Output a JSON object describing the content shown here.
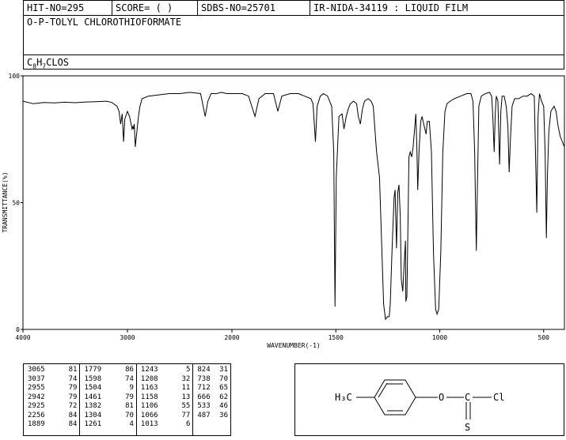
{
  "header": {
    "hit_no": "HIT-NO=295",
    "score": "SCORE=  (   )",
    "sdbs_no": "SDBS-NO=25701",
    "ir_info": "IR-NIDA-34119 : LIQUID FILM",
    "compound_name": "O-P-TOLYL CHLOROTHIOFORMATE",
    "formula": {
      "c": "C",
      "c_n": "8",
      "h": "H",
      "h_n": "7",
      "rest": "CLOS"
    }
  },
  "chart_data": {
    "type": "line",
    "xlabel": "WAVENUMBER(-1)",
    "ylabel": "TRANSMITTANCE(%)",
    "xlim": [
      4000,
      400
    ],
    "ylim": [
      0,
      100
    ],
    "xticks": [
      "4000",
      "3000",
      "2000",
      "1500",
      "1000",
      "500"
    ],
    "xtick_values": [
      4000,
      3000,
      2000,
      1500,
      1000,
      500
    ],
    "yticks": [
      "0",
      "50",
      "100"
    ],
    "ytick_values": [
      0,
      50,
      100
    ],
    "series": [
      {
        "points": [
          [
            4000,
            90
          ],
          [
            3900,
            89
          ],
          [
            3800,
            89.5
          ],
          [
            3700,
            89.3
          ],
          [
            3600,
            89.6
          ],
          [
            3500,
            89.4
          ],
          [
            3400,
            89.7
          ],
          [
            3300,
            89.8
          ],
          [
            3200,
            90
          ],
          [
            3150,
            89.5
          ],
          [
            3100,
            88
          ],
          [
            3080,
            86
          ],
          [
            3065,
            81
          ],
          [
            3050,
            85
          ],
          [
            3037,
            74
          ],
          [
            3025,
            83
          ],
          [
            3000,
            86
          ],
          [
            2980,
            84
          ],
          [
            2955,
            79
          ],
          [
            2948,
            80
          ],
          [
            2942,
            79
          ],
          [
            2935,
            81
          ],
          [
            2925,
            72
          ],
          [
            2910,
            78
          ],
          [
            2895,
            84
          ],
          [
            2880,
            88
          ],
          [
            2860,
            91
          ],
          [
            2800,
            92
          ],
          [
            2700,
            92.5
          ],
          [
            2600,
            93
          ],
          [
            2500,
            93
          ],
          [
            2400,
            93.5
          ],
          [
            2300,
            93
          ],
          [
            2256,
            84
          ],
          [
            2230,
            90
          ],
          [
            2200,
            93
          ],
          [
            2150,
            93
          ],
          [
            2100,
            93.5
          ],
          [
            2050,
            93
          ],
          [
            2000,
            93
          ],
          [
            1950,
            93
          ],
          [
            1920,
            92
          ],
          [
            1889,
            84
          ],
          [
            1870,
            91
          ],
          [
            1840,
            93
          ],
          [
            1800,
            93
          ],
          [
            1779,
            86
          ],
          [
            1760,
            92
          ],
          [
            1720,
            93
          ],
          [
            1680,
            93
          ],
          [
            1650,
            92
          ],
          [
            1620,
            91
          ],
          [
            1610,
            89
          ],
          [
            1598,
            74
          ],
          [
            1590,
            88
          ],
          [
            1575,
            92
          ],
          [
            1560,
            93
          ],
          [
            1540,
            92
          ],
          [
            1520,
            88
          ],
          [
            1510,
            70
          ],
          [
            1504,
            9
          ],
          [
            1498,
            60
          ],
          [
            1485,
            84
          ],
          [
            1470,
            85
          ],
          [
            1461,
            79
          ],
          [
            1450,
            84
          ],
          [
            1440,
            87
          ],
          [
            1430,
            89
          ],
          [
            1415,
            90
          ],
          [
            1400,
            89
          ],
          [
            1392,
            84
          ],
          [
            1382,
            81
          ],
          [
            1372,
            87
          ],
          [
            1362,
            90
          ],
          [
            1345,
            91
          ],
          [
            1330,
            90
          ],
          [
            1320,
            88
          ],
          [
            1304,
            70
          ],
          [
            1290,
            60
          ],
          [
            1280,
            35
          ],
          [
            1270,
            10
          ],
          [
            1261,
            4
          ],
          [
            1252,
            5
          ],
          [
            1243,
            5
          ],
          [
            1238,
            10
          ],
          [
            1230,
            30
          ],
          [
            1220,
            52
          ],
          [
            1215,
            55
          ],
          [
            1208,
            32
          ],
          [
            1202,
            54
          ],
          [
            1196,
            57
          ],
          [
            1190,
            45
          ],
          [
            1185,
            20
          ],
          [
            1178,
            15
          ],
          [
            1172,
            25
          ],
          [
            1165,
            35
          ],
          [
            1163,
            11
          ],
          [
            1158,
            13
          ],
          [
            1153,
            40
          ],
          [
            1148,
            68
          ],
          [
            1142,
            70
          ],
          [
            1135,
            68
          ],
          [
            1128,
            72
          ],
          [
            1120,
            80
          ],
          [
            1115,
            85
          ],
          [
            1110,
            72
          ],
          [
            1106,
            55
          ],
          [
            1100,
            70
          ],
          [
            1092,
            82
          ],
          [
            1085,
            84
          ],
          [
            1080,
            82
          ],
          [
            1066,
            77
          ],
          [
            1060,
            82
          ],
          [
            1050,
            82
          ],
          [
            1040,
            70
          ],
          [
            1030,
            30
          ],
          [
            1020,
            8
          ],
          [
            1013,
            6
          ],
          [
            1005,
            8
          ],
          [
            995,
            30
          ],
          [
            985,
            70
          ],
          [
            975,
            86
          ],
          [
            965,
            89
          ],
          [
            950,
            90
          ],
          [
            930,
            91
          ],
          [
            900,
            92
          ],
          [
            870,
            93
          ],
          [
            850,
            93
          ],
          [
            840,
            90
          ],
          [
            832,
            70
          ],
          [
            824,
            31
          ],
          [
            818,
            60
          ],
          [
            812,
            88
          ],
          [
            800,
            92
          ],
          [
            780,
            93
          ],
          [
            760,
            93.5
          ],
          [
            750,
            92
          ],
          [
            745,
            85
          ],
          [
            738,
            70
          ],
          [
            733,
            85
          ],
          [
            728,
            92
          ],
          [
            720,
            90
          ],
          [
            712,
            65
          ],
          [
            706,
            86
          ],
          [
            700,
            92
          ],
          [
            690,
            92
          ],
          [
            680,
            88
          ],
          [
            672,
            80
          ],
          [
            666,
            62
          ],
          [
            660,
            75
          ],
          [
            652,
            88
          ],
          [
            640,
            91
          ],
          [
            620,
            91
          ],
          [
            600,
            92
          ],
          [
            580,
            92
          ],
          [
            560,
            93
          ],
          [
            545,
            92
          ],
          [
            533,
            46
          ],
          [
            527,
            84
          ],
          [
            520,
            93
          ],
          [
            510,
            90
          ],
          [
            500,
            88
          ],
          [
            493,
            70
          ],
          [
            487,
            36
          ],
          [
            482,
            60
          ],
          [
            475,
            78
          ],
          [
            465,
            86
          ],
          [
            450,
            88
          ],
          [
            440,
            86
          ],
          [
            430,
            80
          ],
          [
            420,
            76
          ],
          [
            410,
            74
          ],
          [
            400,
            72
          ]
        ]
      }
    ]
  },
  "peak_table": {
    "columns": [
      [
        [
          "3065",
          "81"
        ],
        [
          "3037",
          "74"
        ],
        [
          "2955",
          "79"
        ],
        [
          "2942",
          "79"
        ],
        [
          "2925",
          "72"
        ],
        [
          "2256",
          "84"
        ],
        [
          "1889",
          "84"
        ]
      ],
      [
        [
          "1779",
          "86"
        ],
        [
          "1598",
          "74"
        ],
        [
          "1504",
          "9"
        ],
        [
          "1461",
          "79"
        ],
        [
          "1382",
          "81"
        ],
        [
          "1304",
          "70"
        ],
        [
          "1261",
          "4"
        ]
      ],
      [
        [
          "1243",
          "5"
        ],
        [
          "1208",
          "32"
        ],
        [
          "1163",
          "11"
        ],
        [
          "1158",
          "13"
        ],
        [
          "1106",
          "55"
        ],
        [
          "1066",
          "77"
        ],
        [
          "1013",
          "6"
        ]
      ],
      [
        [
          "824",
          "31"
        ],
        [
          "738",
          "70"
        ],
        [
          "712",
          "65"
        ],
        [
          "666",
          "62"
        ],
        [
          "533",
          "46"
        ],
        [
          "487",
          "36"
        ]
      ]
    ]
  },
  "structure": {
    "methyl": "H₃C",
    "oxygen": "O",
    "carbon": "C",
    "chlorine": "Cl",
    "sulfur": "S"
  }
}
